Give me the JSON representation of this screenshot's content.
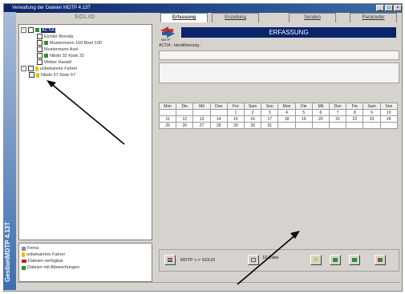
{
  "window": {
    "title": "Verwaltung der Dateien MDTP 4.13T"
  },
  "sidebar": {
    "vertical_label": "GestionMDTP 4.13T"
  },
  "left_panel": {
    "header": "SOLID",
    "tree": [
      {
        "label": "ACTIA",
        "selected": true
      },
      {
        "label": "Eichler Brenda"
      },
      {
        "label": "Mustermann 100 Beet 100"
      },
      {
        "label": "Mustermann Axel"
      },
      {
        "label": "Nikdo 32 Kiste 32"
      },
      {
        "label": "Weber Harald"
      },
      {
        "label": "unbekannte Fahrer"
      },
      {
        "label": "Nikdo 57 Kiste 57"
      }
    ],
    "legend": [
      {
        "label": "Firma"
      },
      {
        "label": "unbekannter Fahrer"
      },
      {
        "label": "Dateien verfügbar"
      },
      {
        "label": "Dateien mit Abweichungen"
      }
    ]
  },
  "tabs": [
    "Erfassung",
    "Erstellung",
    "Senden",
    "Parameter"
  ],
  "main": {
    "banner": "ERFASSUNG",
    "identification_label": "ACTIA - Identifizierung :",
    "calendar": {
      "headers": [
        "Mon",
        "Die",
        "Mit",
        "Don",
        "Fre",
        "Sam",
        "Son",
        "Mon",
        "Die",
        "Mit",
        "Don",
        "Fre",
        "Sam",
        "Son"
      ],
      "rows": [
        [
          "",
          "",
          "",
          "",
          "1",
          "2",
          "3",
          "4",
          "5",
          "6",
          "7",
          "8",
          "9",
          "10"
        ],
        [
          "11",
          "12",
          "13",
          "14",
          "15",
          "16",
          "17",
          "18",
          "19",
          "20",
          "21",
          "22",
          "23",
          "24"
        ],
        [
          "25",
          "26",
          "27",
          "28",
          "29",
          "30",
          "31",
          "",
          "",
          "",
          "",
          "",
          "",
          ""
        ]
      ]
    },
    "bottom": {
      "transfer_label": "MDTP <-> SOLID",
      "count_label": "10 Datei"
    }
  },
  "colors": {
    "banner": "#0a246a",
    "sidebar_bottom": "#3c6fb0"
  }
}
